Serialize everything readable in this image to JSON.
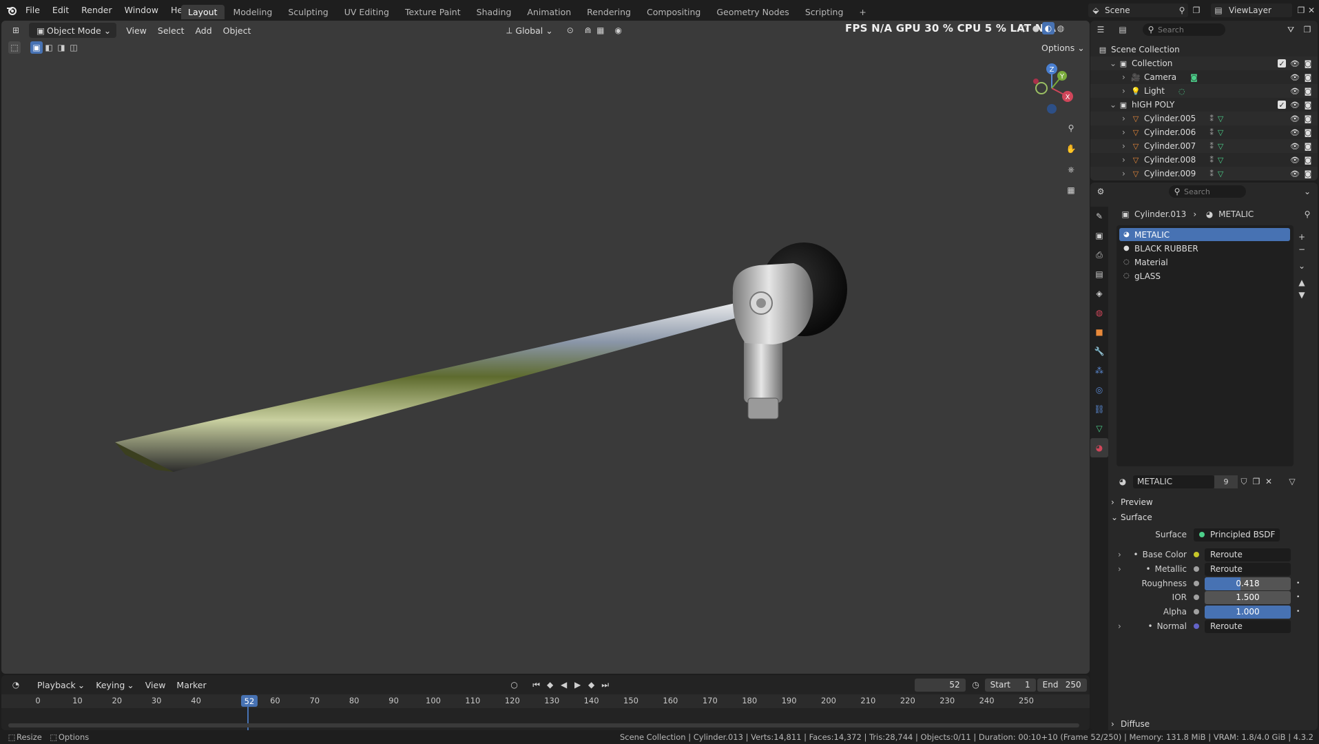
{
  "topbar": {
    "menus": [
      "File",
      "Edit",
      "Render",
      "Window",
      "Help"
    ],
    "workspaces": [
      "Layout",
      "Modeling",
      "Sculpting",
      "UV Editing",
      "Texture Paint",
      "Shading",
      "Animation",
      "Rendering",
      "Compositing",
      "Geometry Nodes",
      "Scripting"
    ],
    "active_workspace": "Layout",
    "add_tab": "+",
    "scene": "Scene",
    "view_layer": "ViewLayer"
  },
  "viewport": {
    "mode": "Object Mode",
    "menus": [
      "View",
      "Select",
      "Add",
      "Object"
    ],
    "orientation": "Global",
    "options": "Options",
    "stats": "FPS N/A GPU 30 % CPU 5 % LAT N/A",
    "gizmo": {
      "x": "X",
      "y": "Y",
      "z": "Z"
    }
  },
  "timeline": {
    "menus": [
      "Playback",
      "Keying",
      "View",
      "Marker"
    ],
    "current_frame": "52",
    "start_label": "Start",
    "start_value": "1",
    "end_label": "End",
    "end_value": "250",
    "ticks": [
      "0",
      "10",
      "20",
      "30",
      "40",
      "50",
      "60",
      "70",
      "80",
      "90",
      "100",
      "110",
      "120",
      "130",
      "140",
      "150",
      "160",
      "170",
      "180",
      "190",
      "200",
      "210",
      "220",
      "230",
      "240",
      "250"
    ]
  },
  "statusbar": {
    "left_items": [
      "Resize",
      "Options"
    ],
    "info": "Scene Collection | Cylinder.013 | Verts:14,811 | Faces:14,372 | Tris:28,744 | Objects:0/11 | Duration: 00:10+10 (Frame 52/250) | Memory: 131.8 MiB | VRAM: 1.8/4.0 GiB | 4.3.2"
  },
  "outliner": {
    "search_placeholder": "Search",
    "rows": [
      {
        "label": "Scene Collection",
        "indent": 0,
        "icon": "scene-collection-icon",
        "vis": false
      },
      {
        "label": "Collection",
        "indent": 1,
        "icon": "collection-icon",
        "vis": true
      },
      {
        "label": "Camera",
        "indent": 2,
        "icon": "camera-icon",
        "vis": true
      },
      {
        "label": "Light",
        "indent": 2,
        "icon": "light-icon",
        "vis": true
      },
      {
        "label": "hIGH POLY",
        "indent": 1,
        "icon": "collection-icon",
        "vis": true
      },
      {
        "label": "Cylinder.005",
        "indent": 2,
        "icon": "mesh-icon",
        "vis": true
      },
      {
        "label": "Cylinder.006",
        "indent": 2,
        "icon": "mesh-icon",
        "vis": true
      },
      {
        "label": "Cylinder.007",
        "indent": 2,
        "icon": "mesh-icon",
        "vis": true
      },
      {
        "label": "Cylinder.008",
        "indent": 2,
        "icon": "mesh-icon",
        "vis": true
      },
      {
        "label": "Cylinder.009",
        "indent": 2,
        "icon": "mesh-icon",
        "vis": true
      }
    ]
  },
  "properties": {
    "search_placeholder": "Search",
    "breadcrumb_object": "Cylinder.013",
    "breadcrumb_material": "METALIC",
    "material_slots": [
      "METALIC",
      "BLACK RUBBER",
      "Material",
      "gLASS"
    ],
    "selected_slot": "METALIC",
    "material_name": "METALIC",
    "user_count": "9",
    "panels": {
      "preview": "Preview",
      "surface": "Surface",
      "diffuse": "Diffuse"
    },
    "surface_label": "Surface",
    "surface_value": "Principled BSDF",
    "inputs": [
      {
        "label": "Base Color",
        "kind": "link",
        "value": "Reroute",
        "socket": "#c7c729"
      },
      {
        "label": "Metallic",
        "kind": "link",
        "value": "Reroute",
        "socket": "#a1a1a1"
      },
      {
        "label": "Roughness",
        "kind": "slider",
        "value": "0.418",
        "fill": 0.418,
        "socket": "#a1a1a1"
      },
      {
        "label": "IOR",
        "kind": "slider",
        "value": "1.500",
        "fill": 0,
        "socket": "#a1a1a1"
      },
      {
        "label": "Alpha",
        "kind": "slider",
        "value": "1.000",
        "fill": 1.0,
        "socket": "#a1a1a1"
      },
      {
        "label": "Normal",
        "kind": "link",
        "value": "Reroute",
        "socket": "#6363c7"
      }
    ]
  },
  "colors": {
    "accent": "#4772b3",
    "viewport_bg": "#3a3a3a",
    "panel_bg": "#282828"
  }
}
